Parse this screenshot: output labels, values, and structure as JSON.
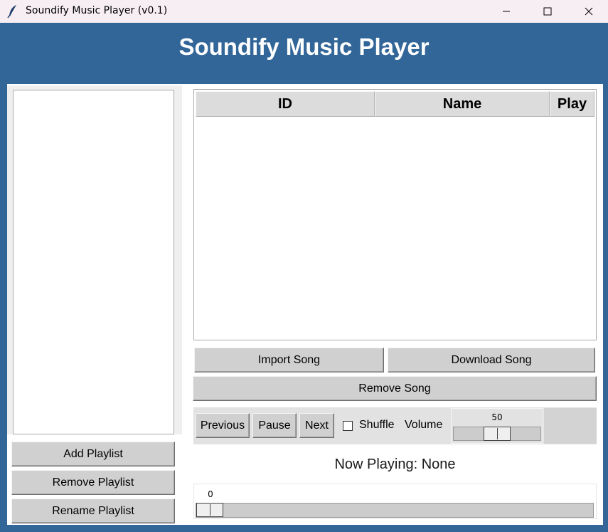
{
  "window": {
    "title": "Soundify Music Player (v0.1)",
    "icon": "feather-icon",
    "controls": [
      "minimize-icon",
      "maximize-icon",
      "close-icon"
    ]
  },
  "header": {
    "title": "Soundify Music Player"
  },
  "playlists": {
    "items": [],
    "buttons": {
      "add": "Add Playlist",
      "remove": "Remove Playlist",
      "rename": "Rename Playlist"
    }
  },
  "songs": {
    "columns": [
      "ID",
      "Name",
      "Play"
    ],
    "rows": []
  },
  "song_buttons": {
    "import": "Import Song",
    "download": "Download Song",
    "remove": "Remove Song"
  },
  "controls": {
    "previous": "Previous",
    "pause": "Pause",
    "next": "Next",
    "shuffle_label": "Shuffle",
    "shuffle_checked": false,
    "volume_label": "Volume",
    "volume_value": "50",
    "volume_min": 0,
    "volume_max": 100
  },
  "now_playing": {
    "text": "Now Playing: None"
  },
  "progress": {
    "value": "0",
    "fraction": 0
  },
  "colors": {
    "background": "#326698",
    "titlebar": "#f7eef3",
    "button": "#d0d0d0",
    "header_text": "#ffffff"
  }
}
